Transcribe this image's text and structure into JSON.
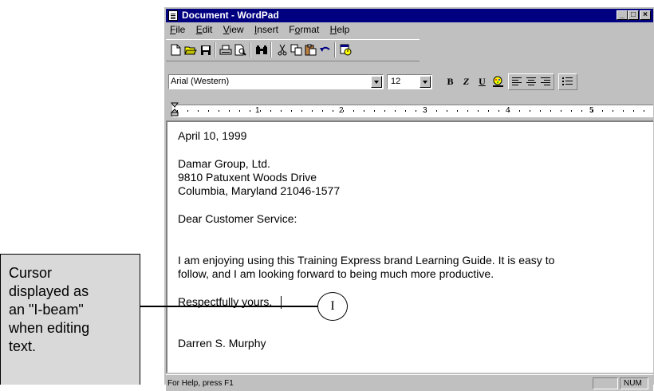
{
  "window": {
    "title": "Document - WordPad",
    "buttons": [
      "minimize",
      "maximize",
      "close"
    ]
  },
  "menu": [
    {
      "label": "File",
      "ul": "F",
      "rest": "ile"
    },
    {
      "label": "Edit",
      "ul": "E",
      "rest": "dit"
    },
    {
      "label": "View",
      "ul": "V",
      "rest": "iew"
    },
    {
      "label": "Insert",
      "ul": "I",
      "rest": "nsert"
    },
    {
      "label": "Format",
      "pre": "F",
      "ul": "o",
      "rest": "rmat"
    },
    {
      "label": "Help",
      "ul": "H",
      "rest": "elp"
    }
  ],
  "toolbar_icons": [
    "new-icon",
    "open-icon",
    "save-icon",
    "print-icon",
    "print-preview-icon",
    "find-icon",
    "cut-icon",
    "copy-icon",
    "paste-icon",
    "undo-icon",
    "insert-datetime-icon"
  ],
  "format": {
    "font": "Arial (Western)",
    "size": "12",
    "buttons": [
      "B",
      "Z",
      "U"
    ]
  },
  "ruler": {
    "numbers": [
      "1",
      "2",
      "3",
      "4",
      "5"
    ]
  },
  "document": {
    "date": "April 10, 1999",
    "address1": "Damar Group, Ltd.",
    "address2": "9810 Patuxent Woods Drive",
    "address3": "Columbia, Maryland  21046-1577",
    "salutation": "Dear Customer Service:",
    "body1": "I am enjoying using this Training Express brand Learning Guide.  It is easy to",
    "body2": "follow, and I am looking forward to being much more productive.",
    "closing": "Respectfully yours,",
    "signature": "Darren S. Murphy"
  },
  "status": {
    "help": "For Help, press F1",
    "num": "NUM"
  },
  "callout": {
    "line1": "Cursor",
    "line2": "displayed as",
    "line3": "an \"I-beam\"",
    "line4": "when editing",
    "line5": "text."
  },
  "ibeam_glyph": "I"
}
